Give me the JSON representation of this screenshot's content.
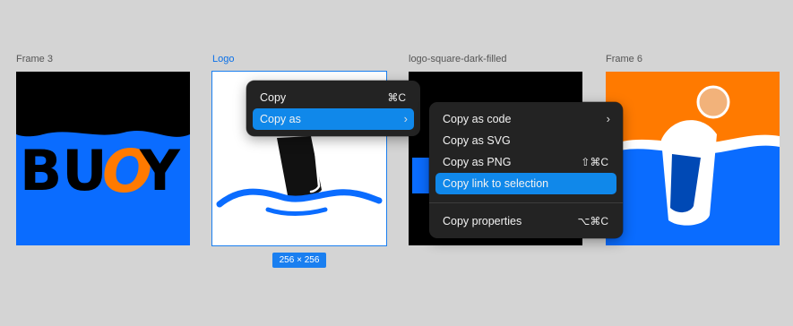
{
  "frames": [
    {
      "label": "Frame 3"
    },
    {
      "label": "Logo"
    },
    {
      "label": "logo-square-dark-filled"
    },
    {
      "label": "Frame 6"
    }
  ],
  "frame3_art": {
    "letters": "BU",
    "orange_letter": "O",
    "last_letter": "Y"
  },
  "size_badge": "256 × 256",
  "menu_primary": {
    "items": [
      {
        "label": "Copy",
        "shortcut": "⌘C"
      },
      {
        "label": "Copy as",
        "submenu_glyph": "›"
      }
    ]
  },
  "menu_copy_as": {
    "items": [
      {
        "label": "Copy as code",
        "submenu_glyph": "›"
      },
      {
        "label": "Copy as SVG"
      },
      {
        "label": "Copy as PNG",
        "shortcut": "⇧⌘C"
      },
      {
        "label": "Copy link to selection"
      },
      {
        "label": "Copy properties",
        "shortcut": "⌥⌘C"
      }
    ]
  },
  "colors": {
    "canvas": "#d4d4d4",
    "selection": "#1a7ff0",
    "brand_blue": "#0a6cff",
    "brand_orange": "#ff7a00",
    "menu_bg": "#232323",
    "menu_highlight": "#1088ea"
  }
}
